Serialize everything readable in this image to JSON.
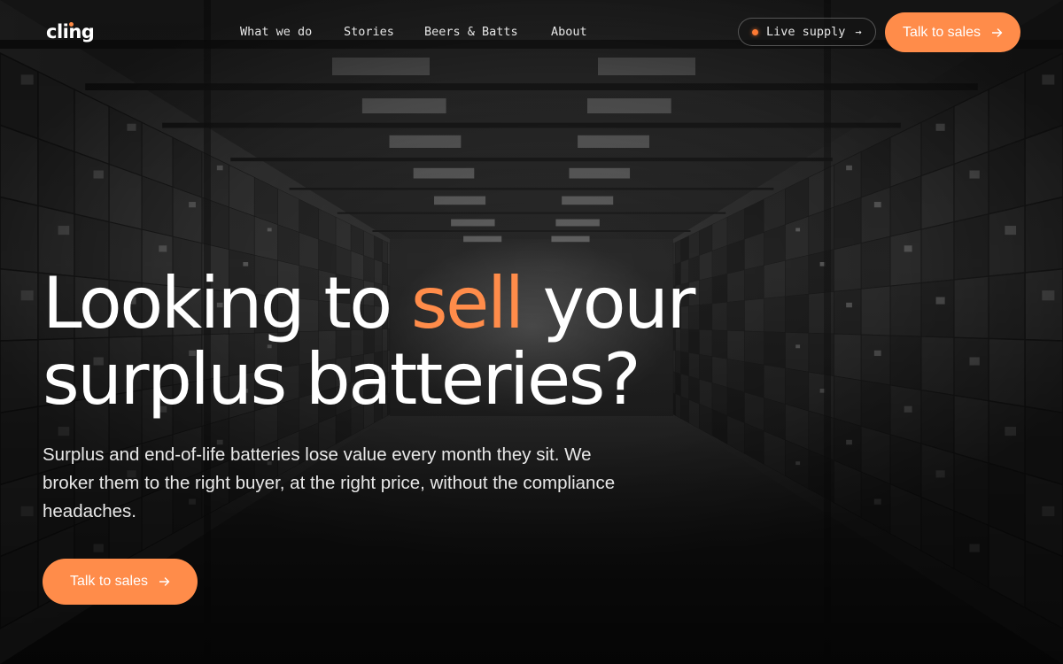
{
  "brand": {
    "logo_text": "cling",
    "accent_color": "#ff8c4a"
  },
  "nav": {
    "items": [
      {
        "label": "What we do"
      },
      {
        "label": "Stories"
      },
      {
        "label": "Beers & Batts"
      },
      {
        "label": "About"
      }
    ]
  },
  "header": {
    "live_supply_label": "Live supply",
    "live_supply_arrow": "→",
    "cta_label": "Talk to sales"
  },
  "hero": {
    "title_part1": "Looking to ",
    "title_accent": "sell",
    "title_part2": " your",
    "title_line2": "surplus batteries?",
    "subtitle": "Surplus and end-of-life batteries lose value every month they sit. We broker them to the right buyer, at the right price, without the compliance headaches.",
    "cta_label": "Talk to sales"
  },
  "icons": {
    "arrow": "arrow-right-icon",
    "live": "live-indicator-dot"
  },
  "background": {
    "description_icon": "warehouse-background-image"
  }
}
